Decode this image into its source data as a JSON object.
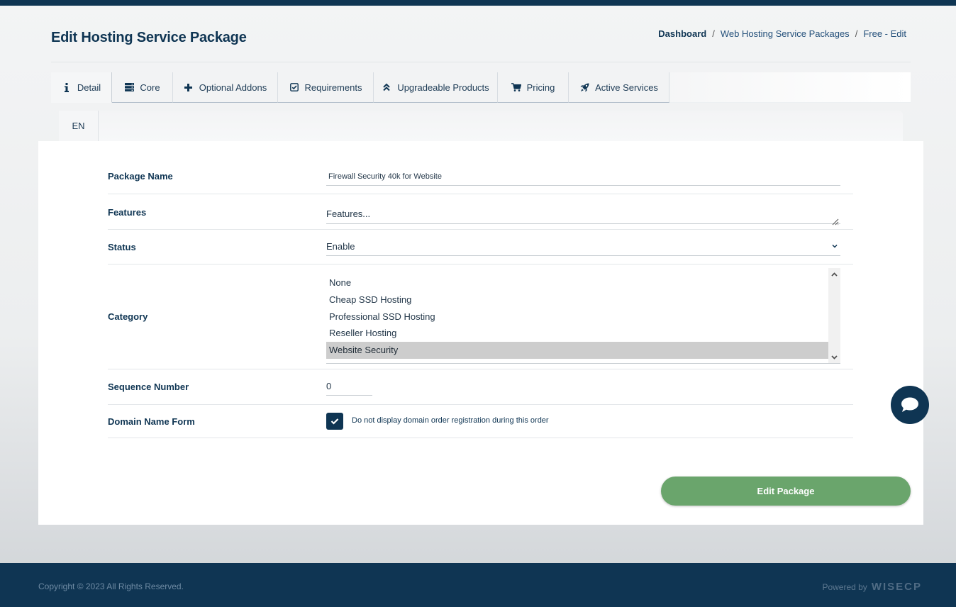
{
  "page": {
    "title": "Edit Hosting Service Package"
  },
  "breadcrumb": {
    "home": "Dashboard",
    "section": "Web Hosting Service Packages",
    "current": "Free - Edit",
    "separator": "/"
  },
  "tabs": [
    {
      "label": "Detail",
      "icon": "info-icon",
      "active": true
    },
    {
      "label": "Core",
      "icon": "server-icon",
      "active": false
    },
    {
      "label": "Optional Addons",
      "icon": "plus-icon",
      "active": false
    },
    {
      "label": "Requirements",
      "icon": "checkbox-icon",
      "active": false
    },
    {
      "label": "Upgradeable Products",
      "icon": "double-chevron-up-icon",
      "active": false
    },
    {
      "label": "Pricing",
      "icon": "cart-icon",
      "active": false
    },
    {
      "label": "Active Services",
      "icon": "rocket-icon",
      "active": false
    }
  ],
  "language_tabs": [
    {
      "label": "EN",
      "active": true
    }
  ],
  "form": {
    "package_name": {
      "label": "Package Name",
      "value": "Firewall Security 40k for Website"
    },
    "features": {
      "label": "Features",
      "placeholder": "Features..."
    },
    "status": {
      "label": "Status",
      "value": "Enable",
      "icon": "chevron-down-icon"
    },
    "category": {
      "label": "Category",
      "options": [
        "None",
        "Cheap SSD Hosting",
        "Professional SSD Hosting",
        "Reseller Hosting",
        "Website Security"
      ],
      "selected": "Website Security"
    },
    "sequence_number": {
      "label": "Sequence Number",
      "value": "0"
    },
    "domain_name_form": {
      "label": "Domain Name Form",
      "checked": true,
      "checkbox_label": "Do not display domain order registration during this order"
    },
    "submit_label": "Edit Package"
  },
  "footer": {
    "copyright": "Copyright © 2023 All Rights Reserved.",
    "powered_by": "Powered by",
    "logo_text": "WISECP"
  },
  "colors": {
    "primary": "#0f3553",
    "submit": "#6aa56c",
    "selected_option": "#cdcdcd"
  }
}
